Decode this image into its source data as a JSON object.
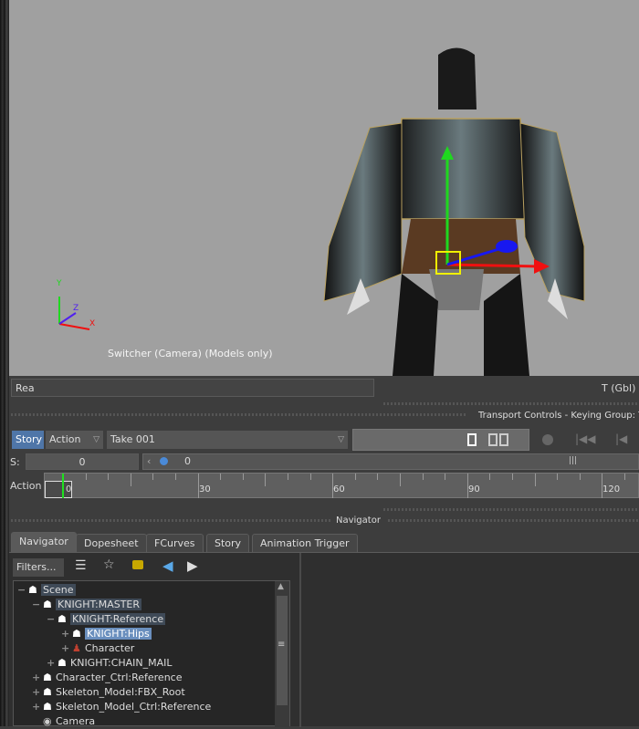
{
  "viewport": {
    "label": "Switcher (Camera) (Models only)",
    "axes": {
      "x": "X",
      "y": "Y",
      "z": "Z"
    }
  },
  "status_field": "Rea",
  "transform_mode": "T (Gbl)",
  "transport_header": "Transport Controls  -  Keying Group: TR",
  "transport": {
    "story_button": "Story",
    "action_dropdown": "Action",
    "take": "Take 001",
    "s_label": "S:",
    "s_value": "0",
    "slider_value": "0",
    "action_label": "Action",
    "current_frame": "0",
    "ticks": [
      "30",
      "60",
      "90",
      "120"
    ]
  },
  "navigator_header": "Navigator",
  "tabs": [
    "Navigator",
    "Dopesheet",
    "FCurves",
    "Story",
    "Animation Trigger"
  ],
  "filters_button": "Filters...",
  "tree": [
    {
      "label": "Scene",
      "depth": 0,
      "toggle": "−",
      "style": "hl"
    },
    {
      "label": "KNIGHT:MASTER",
      "depth": 1,
      "toggle": "−",
      "style": "hl"
    },
    {
      "label": "KNIGHT:Reference",
      "depth": 2,
      "toggle": "−",
      "style": "hl"
    },
    {
      "label": "KNIGHT:Hips",
      "depth": 3,
      "toggle": "+",
      "style": "sel"
    },
    {
      "label": "Character",
      "depth": 3,
      "toggle": "+",
      "style": "",
      "icon": "character"
    },
    {
      "label": "KNIGHT:CHAIN_MAIL",
      "depth": 2,
      "toggle": "+",
      "style": ""
    },
    {
      "label": "Character_Ctrl:Reference",
      "depth": 1,
      "toggle": "+",
      "style": ""
    },
    {
      "label": "Skeleton_Model:FBX_Root",
      "depth": 1,
      "toggle": "+",
      "style": ""
    },
    {
      "label": "Skeleton_Model_Ctrl:Reference",
      "depth": 1,
      "toggle": "+",
      "style": ""
    },
    {
      "label": "Camera",
      "depth": 1,
      "toggle": "",
      "style": "",
      "icon": "camera"
    }
  ]
}
